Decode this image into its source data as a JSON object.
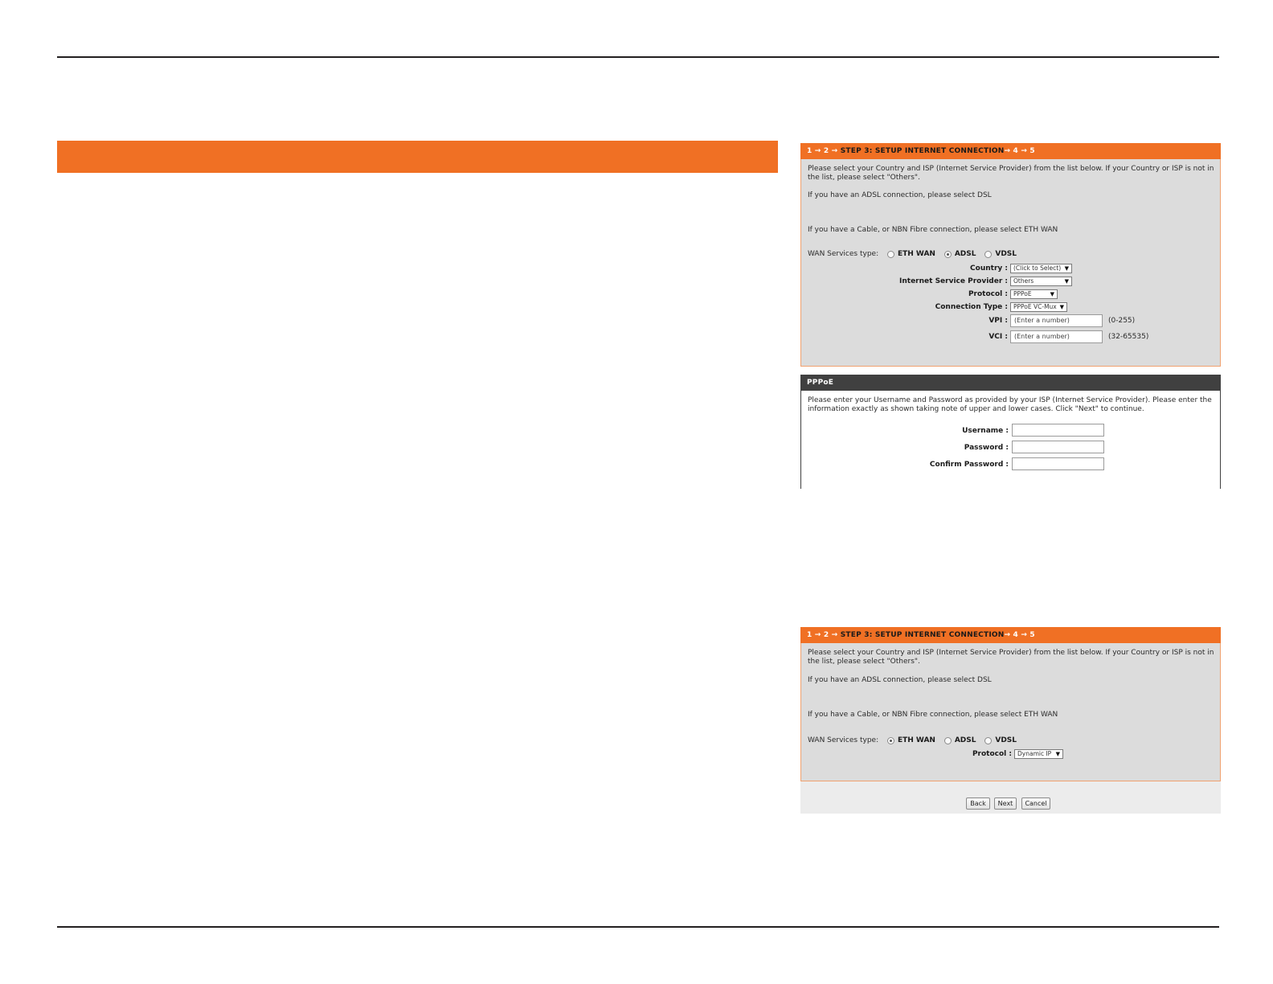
{
  "step_header": {
    "steps_prefix": "1 → 2 → ",
    "step_title": "STEP 3: SETUP INTERNET CONNECTION",
    "steps_suffix": "→ 4 → 5"
  },
  "panel1": {
    "intro": "Please select your Country and ISP (Internet Service Provider) from the list below. If your Country or ISP is not in the list, please select \"Others\".",
    "adsl_note": "If you have an ADSL connection, please select DSL",
    "cable_note": "If you have a Cable, or NBN Fibre connection, please select ETH WAN",
    "wan_label": "WAN Services type:",
    "wan_options": [
      "ETH WAN",
      "ADSL",
      "VDSL"
    ],
    "wan_selected": "ADSL",
    "country_label": "Country :",
    "country_value": "(Click to Select)",
    "isp_label": "Internet Service Provider :",
    "isp_value": "Others",
    "protocol_label": "Protocol :",
    "protocol_value": "PPPoE",
    "conn_type_label": "Connection Type :",
    "conn_type_value": "PPPoE VC-Mux",
    "vpi_label": "VPI :",
    "vpi_placeholder": "(Enter a number)",
    "vpi_range": "(0-255)",
    "vci_label": "VCI :",
    "vci_placeholder": "(Enter a number)",
    "vci_range": "(32-65535)"
  },
  "pppoe": {
    "title": "PPPoE",
    "intro": "Please enter your Username and Password as provided by your ISP (Internet Service Provider). Please enter the information exactly as shown taking note of upper and lower cases. Click \"Next\" to continue.",
    "username_label": "Username :",
    "password_label": "Password :",
    "confirm_label": "Confirm Password :",
    "username_value": "",
    "password_value": "",
    "confirm_value": ""
  },
  "panel2": {
    "intro": "Please select your Country and ISP (Internet Service Provider) from the list below. If your Country or ISP is not in the list, please select \"Others\".",
    "adsl_note": "If you have an ADSL connection, please select DSL",
    "cable_note": "If you have a Cable, or NBN Fibre connection, please select ETH WAN",
    "wan_label": "WAN Services type:",
    "wan_options": [
      "ETH WAN",
      "ADSL",
      "VDSL"
    ],
    "wan_selected": "ETH WAN",
    "protocol_label": "Protocol :",
    "protocol_value": "Dynamic IP"
  },
  "buttons": {
    "back": "Back",
    "next": "Next",
    "cancel": "Cancel"
  },
  "colors": {
    "accent_orange": "#f07024",
    "dark_header": "#404040",
    "panel_gray": "#dcdcdc"
  }
}
